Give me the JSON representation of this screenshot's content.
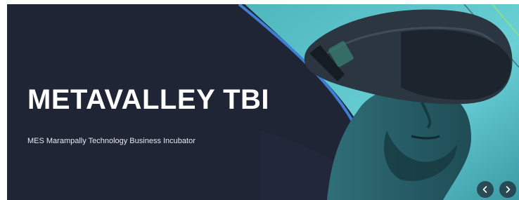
{
  "hero": {
    "title": "METAVALLEY TBI",
    "subtitle": "MES Marampally Technology Business Incubator",
    "image": "person-wearing-vr-headset"
  },
  "carousel": {
    "prev_icon": "chevron-left-icon",
    "next_icon": "chevron-right-icon"
  },
  "colors": {
    "navy_background": "#1f2535",
    "teal_panel": "#5fc6cc",
    "accent_line": "#3d7fd6",
    "headline_text": "#ffffff"
  }
}
